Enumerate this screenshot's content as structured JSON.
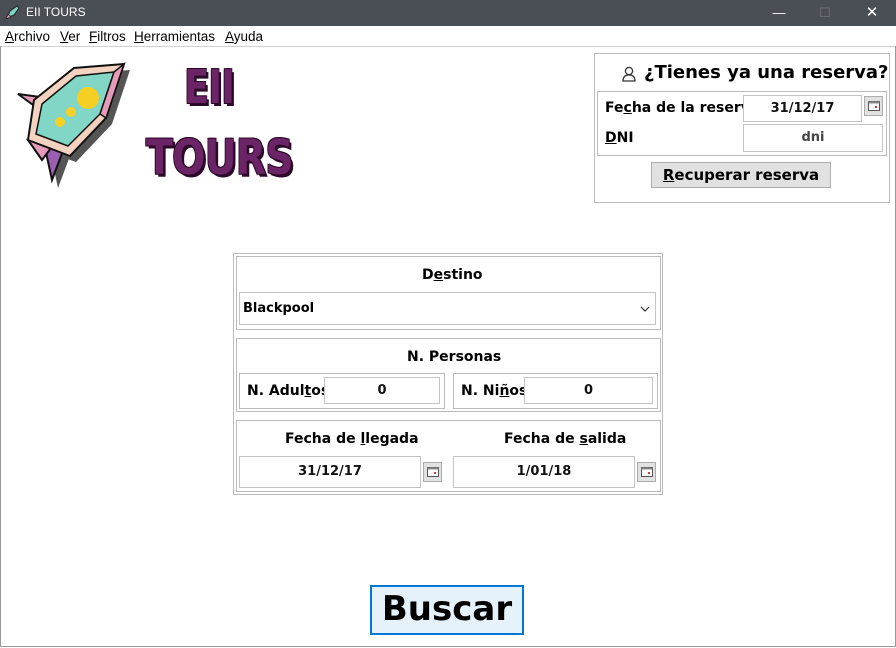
{
  "window": {
    "title": "EII TOURS",
    "minimize": "—",
    "maximize": "☐",
    "close": "✕"
  },
  "menu": [
    {
      "label": "Archivo",
      "mnemonic": "A",
      "rest": "rchivo"
    },
    {
      "label": "Ver",
      "mnemonic": "V",
      "rest": "er"
    },
    {
      "label": "Filtros",
      "mnemonic": "F",
      "rest": "iltros"
    },
    {
      "label": "Herramientas",
      "mnemonic": "H",
      "rest": "erramientas"
    },
    {
      "label": "Ayuda",
      "mnemonic": "A",
      "rest": "yuda"
    }
  ],
  "logo": {
    "line1": "EII",
    "line2": "TOURS"
  },
  "reserva": {
    "heading": "¿Tienes ya una reserva?",
    "fecha_label_pre": "Fe",
    "fecha_label_u": "c",
    "fecha_label_post": "ha de la reserva",
    "fecha_value": "31/12/17",
    "dni_label_u": "D",
    "dni_label_post": "NI",
    "dni_placeholder": "dni",
    "button_u": "R",
    "button_post": "ecuperar reserva"
  },
  "busqueda": {
    "destino_label_pre": "D",
    "destino_label_u": "e",
    "destino_label_post": "stino",
    "destino_value": "Blackpool",
    "personas_label": "N. Personas",
    "adultos_label_pre": "N. Adul",
    "adultos_label_u": "t",
    "adultos_label_post": "os",
    "adultos_value": "0",
    "ninos_label_pre": "N. Ni",
    "ninos_label_u": "ñ",
    "ninos_label_post": "os",
    "ninos_value": "0",
    "llegada_label_pre": "Fecha de ",
    "llegada_label_u": "l",
    "llegada_label_post": "legada",
    "llegada_value": "31/12/17",
    "salida_label_pre": "Fecha de ",
    "salida_label_u": "s",
    "salida_label_post": "alida",
    "salida_value": "1/01/18"
  },
  "buscar_button": "Buscar",
  "colors": {
    "titlebar": "#4a4f55",
    "accent": "#0078d7",
    "logo": "#6b2466"
  }
}
